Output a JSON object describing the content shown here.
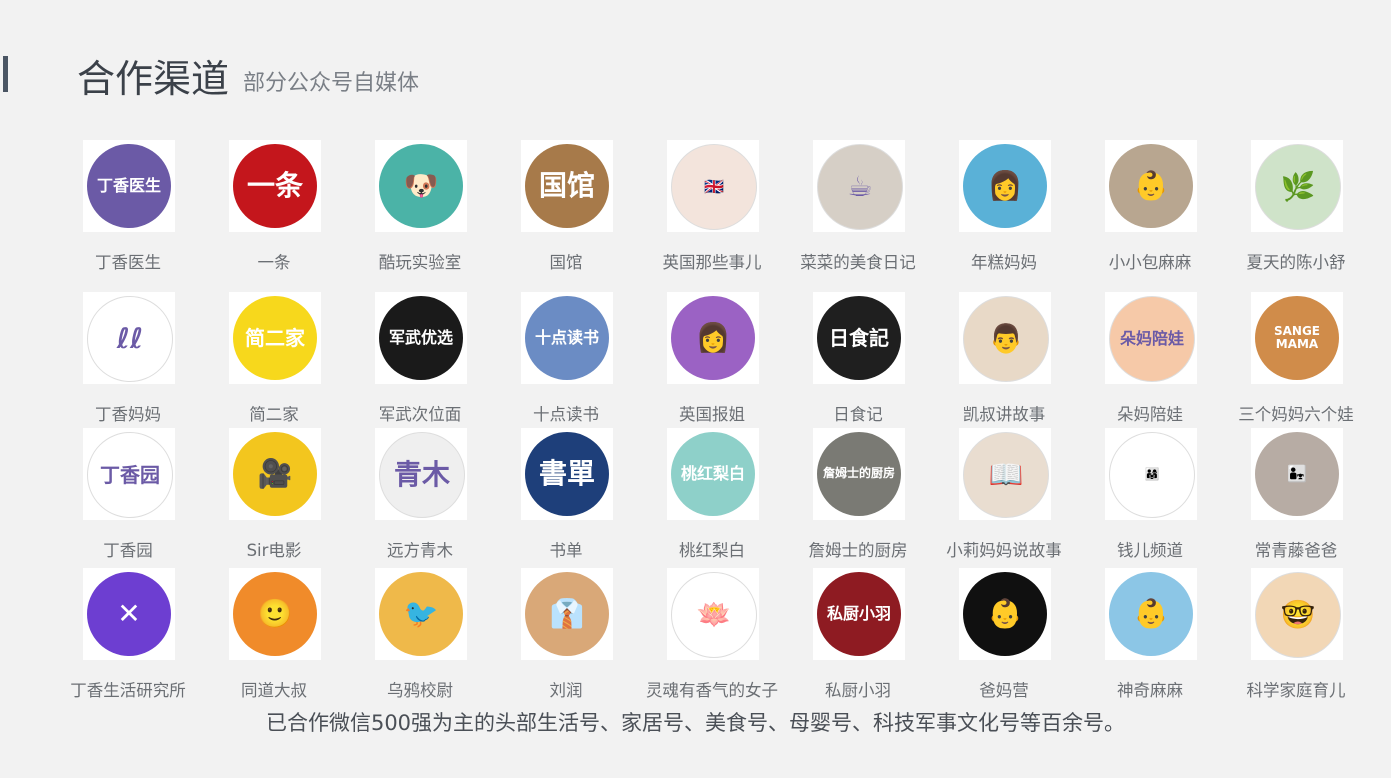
{
  "header": {
    "title": "合作渠道",
    "subtitle": "部分公众号自媒体"
  },
  "rows": [
    {
      "items": [
        {
          "name": "丁香医生",
          "logo_text": "丁香医生",
          "icon": "lilac-flower-icon",
          "color": "#6b5aa6"
        },
        {
          "name": "一条",
          "logo_text": "一条",
          "icon": "yitiao-logo",
          "color": "#c4161c"
        },
        {
          "name": "酷玩实验室",
          "logo_text": "🐶",
          "icon": "bulldog-icon",
          "color": "#4bb3a7"
        },
        {
          "name": "国馆",
          "logo_text": "国馆",
          "icon": "guoguan-logo",
          "color": "#a77a4a"
        },
        {
          "name": "英国那些事儿",
          "logo_text": "🇬🇧",
          "icon": "cartoon-girl-icon",
          "color": "#f3e4dc"
        },
        {
          "name": "菜菜的美食日记",
          "logo_text": "☕",
          "icon": "photo-avatar",
          "color": "#d6cfc6"
        },
        {
          "name": "年糕妈妈",
          "logo_text": "👩",
          "icon": "photo-avatar",
          "color": "#5ab1d7"
        },
        {
          "name": "小小包麻麻",
          "logo_text": "👶",
          "icon": "baby-photo-avatar",
          "color": "#b8a690"
        },
        {
          "name": "夏天的陈小舒",
          "logo_text": "🌿",
          "icon": "illustration-avatar",
          "color": "#cfe3c9"
        }
      ]
    },
    {
      "items": [
        {
          "name": "丁香妈妈",
          "logo_text": "ℓℓ",
          "icon": "dingxiang-mama-logo",
          "color": "#ffffff"
        },
        {
          "name": "简二家",
          "logo_text": "简二家",
          "icon": "house-icon",
          "color": "#f7d81c"
        },
        {
          "name": "军武次位面",
          "logo_text": "军武优选",
          "icon": "junwu-logo",
          "color": "#1a1a1a"
        },
        {
          "name": "十点读书",
          "logo_text": "十点读书",
          "icon": "book-logo",
          "color": "#6b8cc4"
        },
        {
          "name": "英国报姐",
          "logo_text": "👩",
          "icon": "cartoon-girl-icon",
          "color": "#9b62c4"
        },
        {
          "name": "日食记",
          "logo_text": "日食記",
          "icon": "cat-bowl-logo",
          "color": "#1f1f1f"
        },
        {
          "name": "凯叔讲故事",
          "logo_text": "👨",
          "icon": "photo-avatar",
          "color": "#e8d9c7"
        },
        {
          "name": "朵妈陪娃",
          "logo_text": "朵妈陪娃",
          "icon": "cartoon-kids-icon",
          "color": "#f6c9a8"
        },
        {
          "name": "三个妈妈六个娃",
          "logo_text": "SANGE MAMA",
          "icon": "three-moms-logo",
          "color": "#d08c4a"
        }
      ]
    },
    {
      "items": [
        {
          "name": "丁香园",
          "logo_text": "丁香园",
          "icon": "lilac-flower-icon",
          "color": "#ffffff"
        },
        {
          "name": "Sir电影",
          "logo_text": "🎥",
          "icon": "camera-face-icon",
          "color": "#f3c61e"
        },
        {
          "name": "远方青木",
          "logo_text": "青木",
          "icon": "ink-circle-logo",
          "color": "#efefef"
        },
        {
          "name": "书单",
          "logo_text": "書單",
          "icon": "shudan-logo",
          "color": "#1e3f7a"
        },
        {
          "name": "桃红梨白",
          "logo_text": "桃红梨白",
          "icon": "teacup-icon",
          "color": "#8ed0c9"
        },
        {
          "name": "詹姆士的厨房",
          "logo_text": "詹姆士的厨房",
          "icon": "kitchen-logo",
          "color": "#7a7a74"
        },
        {
          "name": "小莉妈妈说故事",
          "logo_text": "📖",
          "icon": "photo-avatar",
          "color": "#e9ddd0"
        },
        {
          "name": "钱儿频道",
          "logo_text": "👨‍👩‍👧",
          "icon": "cartoon-family-icon",
          "color": "#ffffff"
        },
        {
          "name": "常青藤爸爸",
          "logo_text": "👨‍👧",
          "icon": "photo-avatar",
          "color": "#b7aca4"
        }
      ]
    },
    {
      "items": [
        {
          "name": "丁香生活研究所",
          "logo_text": "✕",
          "icon": "lilac-flower-icon",
          "color": "#6d3ed1"
        },
        {
          "name": "同道大叔",
          "logo_text": "🙂",
          "icon": "uncle-face-icon",
          "color": "#f08b2a"
        },
        {
          "name": "乌鸦校尉",
          "logo_text": "🐦",
          "icon": "crow-icon",
          "color": "#efb94a"
        },
        {
          "name": "刘润",
          "logo_text": "👔",
          "icon": "photo-avatar",
          "color": "#d9a878"
        },
        {
          "name": "灵魂有香气的女子",
          "logo_text": "🪷",
          "icon": "lotus-icon",
          "color": "#ffffff"
        },
        {
          "name": "私厨小羽",
          "logo_text": "私厨小羽",
          "icon": "sichu-logo",
          "color": "#8e1b22"
        },
        {
          "name": "爸妈营",
          "logo_text": "👶",
          "icon": "photo-avatar",
          "color": "#101010"
        },
        {
          "name": "神奇麻麻",
          "logo_text": "👶",
          "icon": "baby-photo-avatar",
          "color": "#8cc6e6"
        },
        {
          "name": "科学家庭育儿",
          "logo_text": "🤓",
          "icon": "glasses-man-icon",
          "color": "#f2d7b6"
        }
      ]
    }
  ],
  "footer": {
    "text": "已合作微信500强为主的头部生活号、家居号、美食号、母婴号、科技军事文化号等百余号。"
  }
}
